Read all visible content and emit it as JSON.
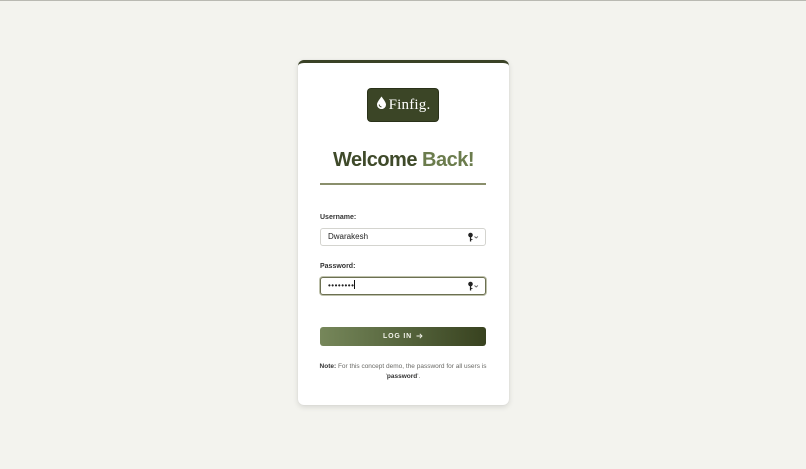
{
  "brand": {
    "name": "Finfig."
  },
  "heading": {
    "word1": "Welcome",
    "word2": "Back!"
  },
  "form": {
    "username_label": "Username:",
    "username_value": "Dwarakesh",
    "password_label": "Password:",
    "password_value": "••••••••",
    "login_label": "LOG IN"
  },
  "note": {
    "prefix": "Note:",
    "text": " For this concept demo, the password for all users is '",
    "password_word": "password",
    "suffix": "'."
  },
  "colors": {
    "accent_dark": "#3b4526",
    "accent_light": "#76875a",
    "background": "#f3f3ee"
  },
  "icons": {
    "logo": "droplet-icon",
    "field_action": "key-icon",
    "button_arrow": "arrow-right-icon"
  }
}
